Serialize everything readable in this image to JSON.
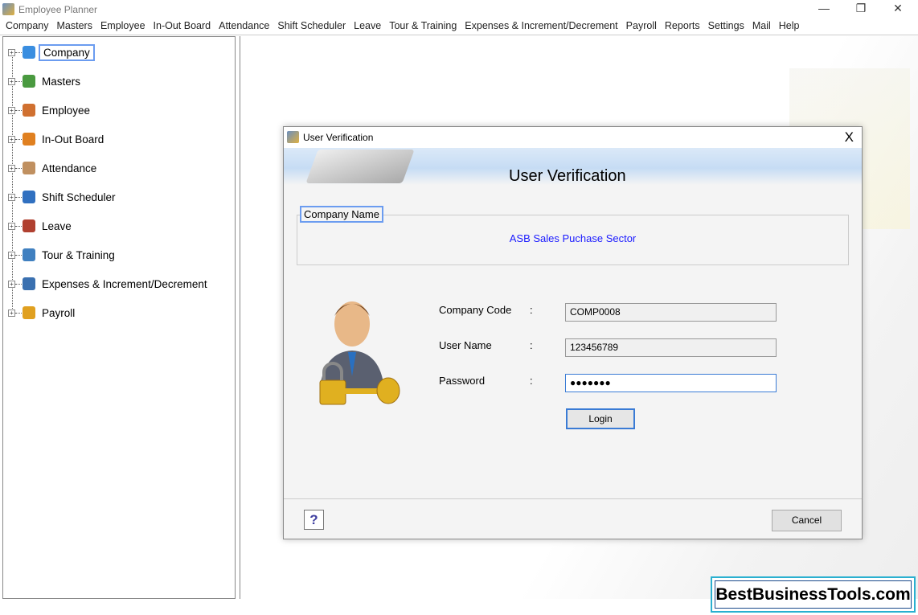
{
  "window": {
    "title": "Employee Planner",
    "minimize": "—",
    "maximize": "❐",
    "close": "✕"
  },
  "menu": [
    "Company",
    "Masters",
    "Employee",
    "In-Out Board",
    "Attendance",
    "Shift Scheduler",
    "Leave",
    "Tour & Training",
    "Expenses & Increment/Decrement",
    "Payroll",
    "Reports",
    "Settings",
    "Mail",
    "Help"
  ],
  "tree": [
    {
      "label": "Company",
      "icon": "building-icon",
      "color": "#3a8ee0",
      "selected": true
    },
    {
      "label": "Masters",
      "icon": "layers-icon",
      "color": "#4a9a40"
    },
    {
      "label": "Employee",
      "icon": "people-icon",
      "color": "#d07030"
    },
    {
      "label": "In-Out Board",
      "icon": "arrows-icon",
      "color": "#e08020"
    },
    {
      "label": "Attendance",
      "icon": "checklist-icon",
      "color": "#c09060"
    },
    {
      "label": "Shift Scheduler",
      "icon": "clock-icon",
      "color": "#3070c0"
    },
    {
      "label": "Leave",
      "icon": "calendar-icon",
      "color": "#b04030"
    },
    {
      "label": "Tour & Training",
      "icon": "airplane-icon",
      "color": "#4080c0"
    },
    {
      "label": "Expenses & Increment/Decrement",
      "icon": "wallet-icon",
      "color": "#3a70b0"
    },
    {
      "label": "Payroll",
      "icon": "coin-icon",
      "color": "#e0a020"
    }
  ],
  "dialog": {
    "title": "User Verification",
    "close": "X",
    "banner_title": "User Verification",
    "company_group_label": "Company Name",
    "company_name": "ASB Sales Puchase Sector",
    "fields": [
      {
        "label": "Company Code",
        "value": "COMP0008"
      },
      {
        "label": "User Name",
        "value": "123456789"
      },
      {
        "label": "Password",
        "value": "●●●●●●●"
      }
    ],
    "colon": ":",
    "login": "Login",
    "help": "?",
    "cancel": "Cancel"
  },
  "brand": "BestBusinessTools.com"
}
